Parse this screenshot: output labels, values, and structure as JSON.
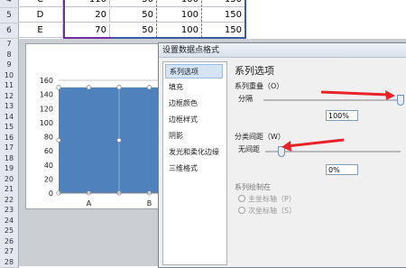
{
  "spreadsheet": {
    "top_row_partial": {
      "num": "4",
      "label": "C",
      "values": [
        "110",
        "50",
        "100",
        "150"
      ]
    },
    "rows": [
      {
        "num": "5",
        "label": "D",
        "values": [
          "20",
          "50",
          "100",
          "150"
        ]
      },
      {
        "num": "6",
        "label": "E",
        "values": [
          "70",
          "50",
          "100",
          "150"
        ]
      }
    ],
    "row_numbers": [
      "7",
      "8",
      "9",
      "10",
      "11",
      "12",
      "13",
      "14",
      "15",
      "16",
      "17",
      "18",
      "19",
      "20",
      "21",
      "22",
      "23",
      "24",
      "25",
      "26",
      "27",
      "28"
    ]
  },
  "chart_data": {
    "type": "bar",
    "categories": [
      "A",
      "B"
    ],
    "values": [
      150,
      150
    ],
    "ylim": [
      0,
      160
    ],
    "yticks": [
      "0",
      "20",
      "40",
      "60",
      "80",
      "100",
      "120",
      "140",
      "160"
    ],
    "bar_color": "#4f81bd",
    "gridlines": true
  },
  "dialog": {
    "title": "设置数据点格式",
    "nav": [
      "系列选项",
      "填充",
      "边框颜色",
      "边框样式",
      "阴影",
      "发光和柔化边缘",
      "三维格式"
    ],
    "section_title": "系列选项",
    "overlap": {
      "label": "系列重叠（O）",
      "left": "分隔",
      "value": "100%"
    },
    "gap": {
      "label": "分类间距（W）",
      "left": "无间距",
      "value": "0%"
    },
    "plot_on": {
      "label": "系列绘制在",
      "primary": "主坐标轴（P）",
      "secondary": "次坐标轴（S）"
    }
  },
  "colors": {
    "arrow": "#e8232a",
    "accent": "#4f81bd"
  }
}
